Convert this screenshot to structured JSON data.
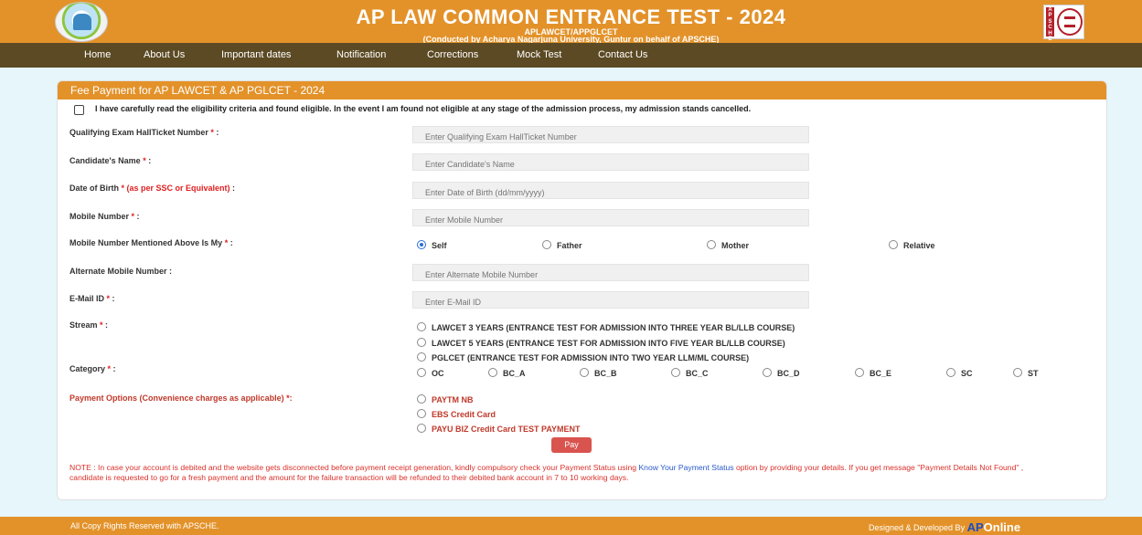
{
  "header": {
    "title": "AP LAW COMMON ENTRANCE TEST - 2024",
    "subtitle": "APLAWCET/APPGLCET",
    "conducted_by": "(Conducted by Acharya Nagarjuna University, Guntur on behalf of APSCHE)",
    "right_logo_text": "APSCHE"
  },
  "nav": [
    "Home",
    "About Us",
    "Important dates",
    "Notification",
    "Corrections",
    "Mock Test",
    "Contact Us"
  ],
  "form": {
    "heading": "Fee Payment for AP LAWCET & AP PGLCET - 2024",
    "declaration": "I have carefully read the eligibility criteria and found eligible. In the event I am found not eligible at any stage of the admission process, my admission stands cancelled.",
    "fields": [
      {
        "label": "Qualifying Exam HallTicket Number",
        "required": "*",
        "suffix": " :",
        "placeholder": "Enter Qualifying Exam HallTicket Number"
      },
      {
        "label": "Candidate's Name",
        "required": "*",
        "suffix": " :",
        "placeholder": "Enter Candidate's Name"
      },
      {
        "label": "Date of Birth",
        "required": "* (as per SSC or Equivalent)",
        "suffix": " :",
        "placeholder": "Enter Date of Birth (dd/mm/yyyy)"
      },
      {
        "label": "Mobile Number",
        "required": "*",
        "suffix": " :",
        "placeholder": "Enter Mobile Number"
      },
      {
        "label": "Alternate Mobile Number",
        "required": "",
        "suffix": " :",
        "placeholder": "Enter Alternate Mobile Number"
      },
      {
        "label": "E-Mail ID",
        "required": "*",
        "suffix": " :",
        "placeholder": "Enter E-Mail ID"
      }
    ],
    "mobile_owner": {
      "label": "Mobile Number Mentioned Above Is My",
      "required": "*",
      "suffix": " :",
      "options": [
        "Self",
        "Father",
        "Mother",
        "Relative"
      ],
      "selected": "Self"
    },
    "stream": {
      "label": "Stream",
      "required": "*",
      "suffix": " :",
      "options": [
        "LAWCET 3 YEARS (ENTRANCE TEST FOR ADMISSION INTO THREE YEAR BL/LLB COURSE)",
        "LAWCET 5 YEARS (ENTRANCE TEST FOR ADMISSION INTO FIVE YEAR BL/LLB COURSE)",
        "PGLCET (ENTRANCE TEST FOR ADMISSION INTO TWO YEAR LLM/ML COURSE)"
      ]
    },
    "category": {
      "label": "Category",
      "required": "*",
      "suffix": " :",
      "options": [
        "OC",
        "BC_A",
        "BC_B",
        "BC_C",
        "BC_D",
        "BC_E",
        "SC",
        "ST"
      ]
    },
    "payment": {
      "label": "Payment Options (Convenience charges as applicable)",
      "required": "*",
      "suffix": ":",
      "options": [
        "PAYTM NB",
        "EBS Credit Card",
        "PAYU BIZ Credit Card TEST PAYMENT"
      ]
    },
    "pay_button": "Pay",
    "note": {
      "prefix": "NOTE : In case your account is debited and the website gets disconnected before payment receipt generation, kindly compulsory check your Payment Status using ",
      "link": "Know Your Payment Status",
      "suffix": " option by providing your details. If you get message \"Payment Details Not Found\" , candidate is requested to go for a fresh payment and the amount for the failure transaction will be refunded to their debited bank account in 7 to 10 working days."
    }
  },
  "footer": {
    "copyright": "All Copy Rights Reserved with APSCHE.",
    "designed_by": "Designed & Developed By ",
    "brand_ap": "AP",
    "brand_online": "Online"
  },
  "colors": {
    "header": "#e3922a",
    "nav": "#5c4a24",
    "background": "#e6f6fb",
    "accent_red": "#d9534f"
  }
}
